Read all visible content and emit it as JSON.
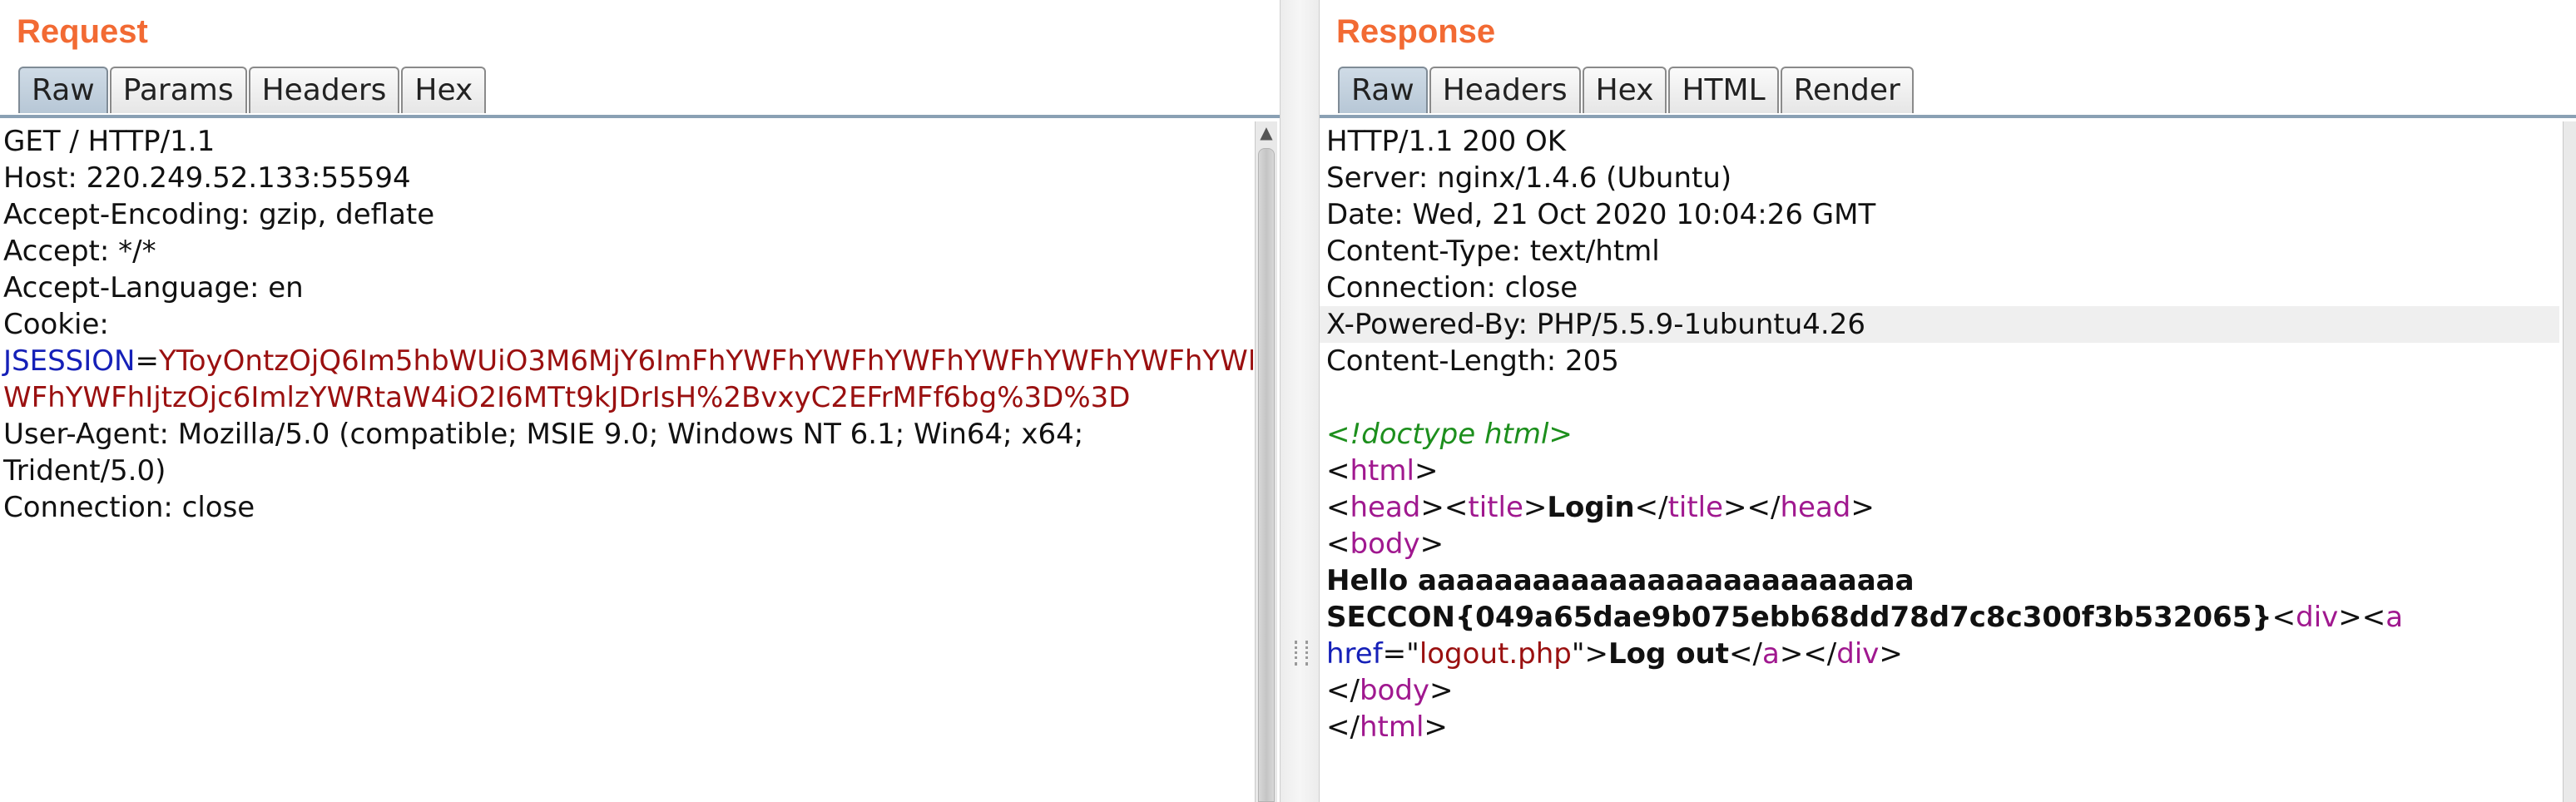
{
  "request": {
    "title": "Request",
    "tabs": [
      "Raw",
      "Params",
      "Headers",
      "Hex"
    ],
    "lines": {
      "l1": "GET / HTTP/1.1",
      "l2": "Host: 220.249.52.133:55594",
      "l3": "Accept-Encoding: gzip, deflate",
      "l4": "Accept: */*",
      "l5": "Accept-Language: en",
      "l6": "Cookie:",
      "cookie_name": "JSESSION",
      "cookie_eq": "=",
      "cookie_val_1": "YToyOntzOjQ6Im5hbWUiO3M6MjY6ImFhYWFhYWFhYWFhYWFhYWFhYWFhYWFhY",
      "cookie_val_2": "WFhYWFhIjtzOjc6ImlzYWRtaW4iO2I6MTt9kJDrIsH%2BvxyC2EFrMFf6bg%3D%3D",
      "l9": "User-Agent: Mozilla/5.0 (compatible; MSIE 9.0; Windows NT 6.1; Win64; x64;",
      "l10": "Trident/5.0)",
      "l11": "Connection: close"
    }
  },
  "response": {
    "title": "Response",
    "tabs": [
      "Raw",
      "Headers",
      "Hex",
      "HTML",
      "Render"
    ],
    "lines": {
      "l1": "HTTP/1.1 200 OK",
      "l2": "Server: nginx/1.4.6 (Ubuntu)",
      "l3": "Date: Wed, 21 Oct 2020 10:04:26 GMT",
      "l4": "Content-Type: text/html",
      "l5": "Connection: close",
      "l6": "X-Powered-By: PHP/5.5.9-1ubuntu4.26",
      "l7": "Content-Length: 205",
      "doctype": "<!doctype html>",
      "lt": "<",
      "gt": ">",
      "lt_slash": "</",
      "tag_html": "html",
      "tag_head": "head",
      "tag_title": "title",
      "tag_body": "body",
      "tag_div": "div",
      "tag_a": "a",
      "title_text": "Login",
      "hello": "Hello aaaaaaaaaaaaaaaaaaaaaaaaaa",
      "flag": "SECCON{049a65dae9b075ebb68dd78d7c8c300f3b532065}",
      "attr_href": "href",
      "attr_eq_q": "=\"",
      "attr_val": "logout.php",
      "attr_close": "\">",
      "logout_text": "Log out"
    }
  }
}
